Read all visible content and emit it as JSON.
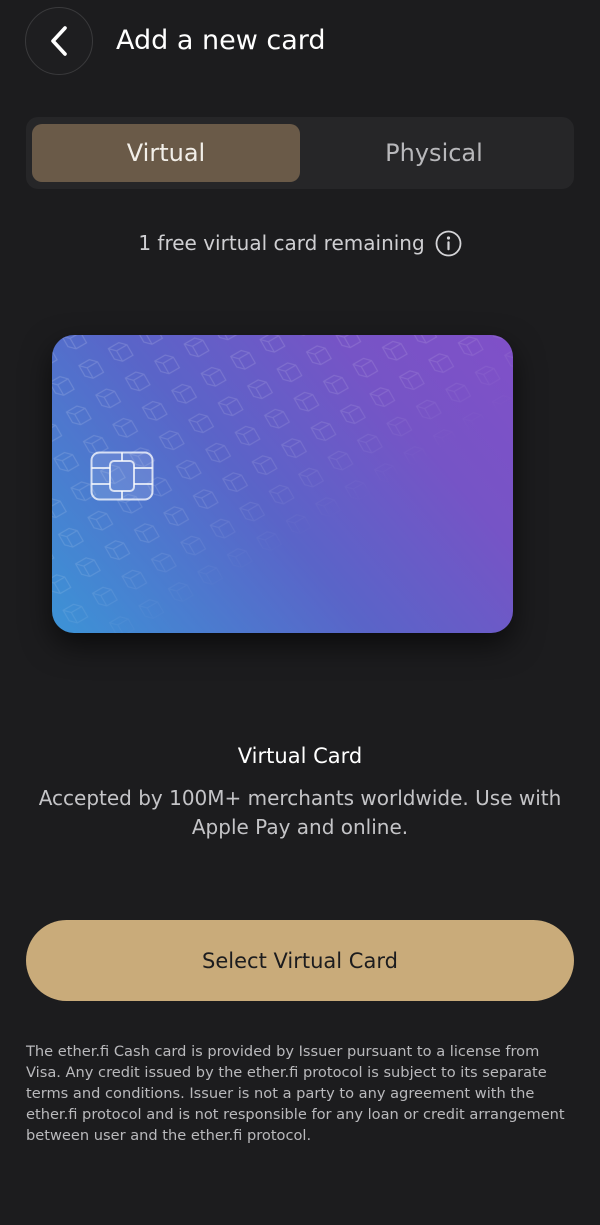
{
  "header": {
    "title": "Add a new card",
    "back_icon": "chevron-left-icon"
  },
  "tabs": [
    {
      "label": "Virtual",
      "selected": true
    },
    {
      "label": "Physical",
      "selected": false
    }
  ],
  "remaining": {
    "text": "1 free virtual card remaining",
    "icon": "info-icon"
  },
  "card_preview": {
    "chip_icon": "card-chip-icon",
    "gradient_colors": [
      "#3c93d6",
      "#5a64c8",
      "#7654c6",
      "#8050c8"
    ]
  },
  "card_info": {
    "title": "Virtual Card",
    "description": "Accepted by 100M+ merchants worldwide. Use with Apple Pay and online."
  },
  "cta": {
    "label": "Select Virtual Card",
    "color": "#c9ab7a"
  },
  "disclaimer": {
    "text": "The ether.fi Cash card is provided by Issuer pursuant to a license from Visa. Any credit issued by the ether.fi protocol is subject to its separate terms and conditions. Issuer is not a party to any agreement with the ether.fi protocol and is not responsible for any loan or credit arrangement between user and the ether.fi protocol."
  },
  "colors": {
    "background": "#1c1c1e",
    "tab_selected": "#6a5a48",
    "tab_bar": "#262628"
  }
}
